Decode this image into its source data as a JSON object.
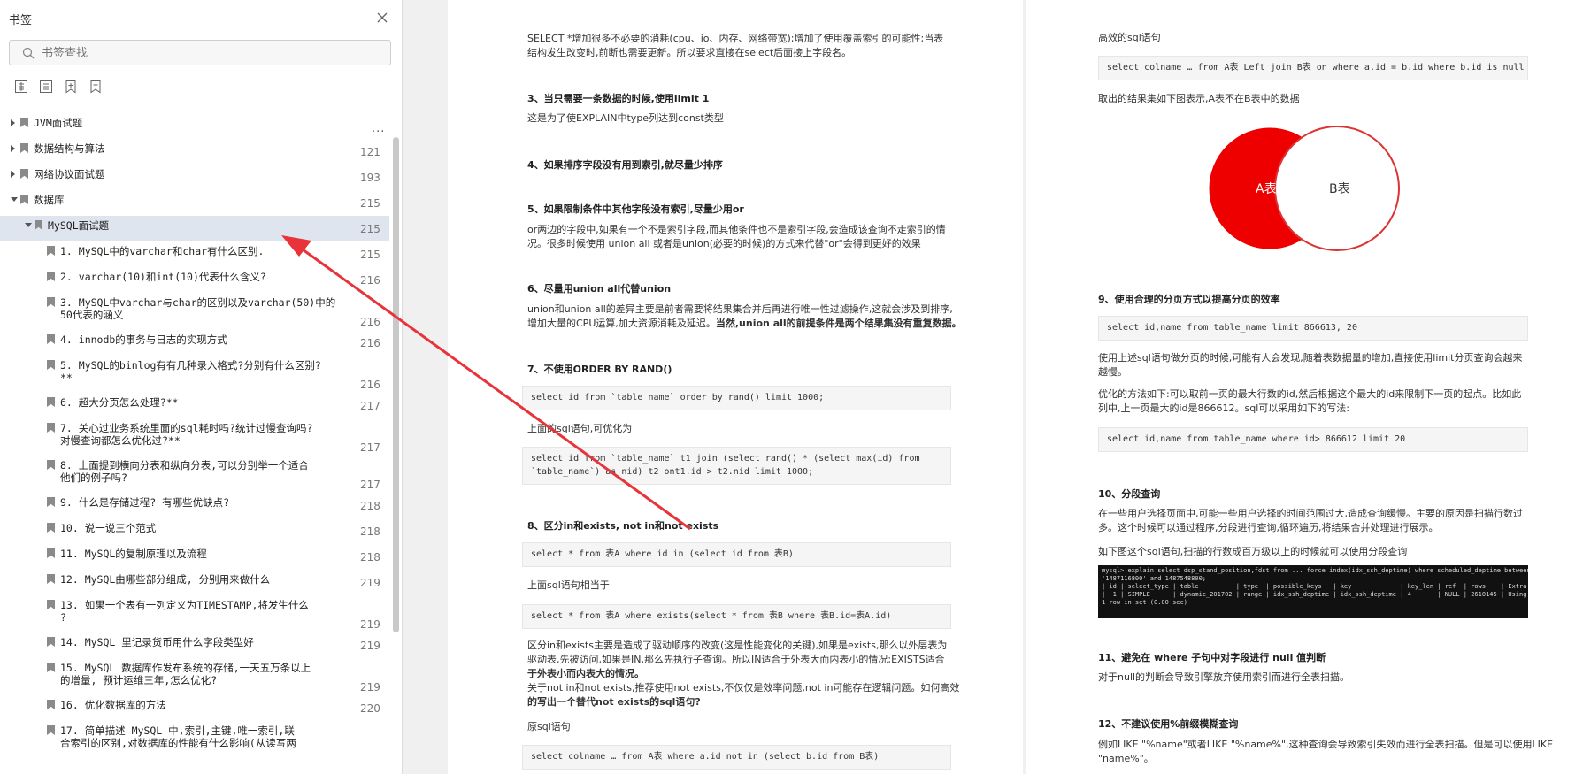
{
  "sidebar": {
    "title": "书签",
    "close_icon": "close-icon",
    "search_placeholder": "书签查找",
    "tools": [
      "expand-all-icon",
      "collapse-all-icon",
      "add-bookmark-icon",
      "bookmark-icon"
    ],
    "more": "...",
    "items": [
      {
        "label": "JVM面试题",
        "page": "",
        "level": 0,
        "state": "collapsed"
      },
      {
        "label": "数据结构与算法",
        "page": "121",
        "level": 0,
        "state": "collapsed"
      },
      {
        "label": "网络协议面试题",
        "page": "193",
        "level": 0,
        "state": "collapsed"
      },
      {
        "label": "数据库",
        "page": "215",
        "level": 0,
        "state": "expanded"
      },
      {
        "label": "MySQL面试题",
        "page": "215",
        "level": 1,
        "state": "expanded",
        "selected": true
      },
      {
        "label": "1. MySQL中的varchar和char有什么区别.",
        "page": "215",
        "level": 2
      },
      {
        "label": "2. varchar(10)和int(10)代表什么含义?",
        "page": "216",
        "level": 2
      },
      {
        "label": "3. MySQL中varchar与char的区别以及varchar(50)中的\n50代表的涵义",
        "page": "216",
        "level": 2
      },
      {
        "label": "4. innodb的事务与日志的实现方式",
        "page": "216",
        "level": 2
      },
      {
        "label": "5. MySQL的binlog有有几种录入格式?分别有什么区别?\n**",
        "page": "216",
        "level": 2
      },
      {
        "label": "6. 超大分页怎么处理?**",
        "page": "217",
        "level": 2
      },
      {
        "label": "7. 关心过业务系统里面的sql耗时吗?统计过慢查询吗?\n对慢查询都怎么优化过?**",
        "page": "217",
        "level": 2
      },
      {
        "label": "8. 上面提到横向分表和纵向分表,可以分别举一个适合\n他们的例子吗?",
        "page": "217",
        "level": 2
      },
      {
        "label": "9. 什么是存储过程? 有哪些优缺点?",
        "page": "218",
        "level": 2
      },
      {
        "label": "10. 说一说三个范式",
        "page": "218",
        "level": 2
      },
      {
        "label": "11. MySQL的复制原理以及流程",
        "page": "218",
        "level": 2
      },
      {
        "label": "12. MySQL由哪些部分组成, 分别用来做什么",
        "page": "219",
        "level": 2
      },
      {
        "label": "13. 如果一个表有一列定义为TIMESTAMP,将发生什么\n?",
        "page": "219",
        "level": 2
      },
      {
        "label": "14. MySQL 里记录货币用什么字段类型好",
        "page": "219",
        "level": 2
      },
      {
        "label": "15. MySQL 数据库作发布系统的存储,一天五万条以上\n的增量, 预计运维三年,怎么优化?",
        "page": "219",
        "level": 2
      },
      {
        "label": "16. 优化数据库的方法",
        "page": "220",
        "level": 2
      },
      {
        "label": "17. 简单描述 MySQL 中,索引,主键,唯一索引,联\n合索引的区别,对数据库的性能有什么影响(从读写两",
        "page": "",
        "level": 2
      }
    ]
  },
  "left_page": {
    "p1": "SELECT *增加很多不必要的消耗(cpu、io、内存、网络带宽);增加了使用覆盖索引的可能性;当表",
    "p1b": "结构发生改变时,前断也需要更新。所以要求直接在select后面接上字段名。",
    "h3": "3、当只需要一条数据的时候,使用limit 1",
    "t3": "这是为了使EXPLAIN中type列达到const类型",
    "h4": "4、如果排序字段没有用到索引,就尽量少排序",
    "h5": "5、如果限制条件中其他字段没有索引,尽量少用or",
    "t5a": "or两边的字段中,如果有一个不是索引字段,而其他条件也不是索引字段,会造成该查询不走索引的情",
    "t5b": "况。很多时候使用 union all 或者是union(必要的时候)的方式来代替\"or\"会得到更好的效果",
    "h6": "6、尽量用union all代替union",
    "t6a": "union和union all的差异主要是前者需要将结果集合并后再进行唯一性过滤操作,这就会涉及到排序,",
    "t6b": "增加大量的CPU运算,加大资源消耗及延迟。",
    "t6c": "当然,union all的前提条件是两个结果集没有重复数据。",
    "h7": "7、不使用ORDER BY RAND()",
    "c7": "select id from `table_name` order by rand() limit 1000;",
    "t7": "上面的sql语句,可优化为",
    "c7b1": "select id from `table_name` t1 join (select rand() * (select max(id) from",
    "c7b2": "`table_name`) as nid) t2 ont1.id > t2.nid limit 1000;",
    "h8": "8、区分in和exists, not in和not exists",
    "c8": "select * from 表A where id in (select id from 表B)",
    "t8": "上面sql语句相当于",
    "c8b": "select * from 表A where exists(select * from 表B where 表B.id=表A.id)",
    "t8a": "区分in和exists主要是造成了驱动顺序的改变(这是性能变化的关键),如果是exists,那么以外层表为",
    "t8b": "驱动表,先被访问,如果是IN,那么先执行子查询。所以IN适合于外表大而内表小的情况;EXISTS适合",
    "t8c": "于外表小而内表大的情况。",
    "t8d": "关于not in和not exists,推荐使用not exists,不仅仅是效率问题,not in可能存在逻辑问题。如何高效",
    "t8e": "的写出一个替代not exists的sql语句?",
    "t8f": "原sql语句",
    "c8c": "select colname … from A表 where a.id not in (select b.id from B表)"
  },
  "right_page": {
    "t0": "高效的sql语句",
    "c0": "select colname … from A表 Left join B表 on where a.id = b.id where b.id is null",
    "t0b": "取出的结果集如下图表示,A表不在B表中的数据",
    "venn_a": "A表",
    "venn_b": "B表",
    "venn_color": "#ee0000",
    "h9": "9、使用合理的分页方式以提高分页的效率",
    "c9": "select id,name from table_name limit 866613, 20",
    "t9a": "使用上述sql语句做分页的时候,可能有人会发现,随着表数据量的增加,直接使用limit分页查询会越来",
    "t9b": "越慢。",
    "t9c": "优化的方法如下:可以取前一页的最大行数的id,然后根据这个最大的id来限制下一页的起点。比如此",
    "t9d": "列中,上一页最大的id是866612。sql可以采用如下的写法:",
    "c9b": "select id,name from table_name where id> 866612 limit 20",
    "h10": "10、分段查询",
    "t10a": "在一些用户选择页面中,可能一些用户选择的时间范围过大,造成查询缓慢。主要的原因是扫描行数过",
    "t10b": "多。这个时候可以通过程序,分段进行查询,循环遍历,将结果合并处理进行展示。",
    "t10c": "如下图这个sql语句,扫描的行数成百万级以上的时候就可以使用分段查询",
    "shot1": "mysql> explain select dsp_stand_position,fdst from ... force index(idx_ssh_deptime) where scheduled_deptime between",
    "shot2": "'1487116800' and 1487548800;",
    "shot3": "| id | select_type | table          | type  | possible_keys   | key             | key_len | ref  | rows    | Extra",
    "shot4": "|  1 | SIMPLE      | dynamic_201702 | range | idx_ssh_deptime | idx_ssh_deptime | 4       | NULL | 2610145 | Using index condition",
    "shot5": "1 row in set (0.00 sec)",
    "h11": "11、避免在 where 子句中对字段进行 null 值判断",
    "t11": "对于null的判断会导致引擎放弃使用索引而进行全表扫描。",
    "h12": "12、不建议使用%前缀模糊查询",
    "t12a": "例如LIKE \"%name\"或者LIKE \"%name%\",这种查询会导致索引失效而进行全表扫描。但是可以使用LIKE",
    "t12b": "\"name%\"。"
  },
  "annotation": {
    "color": "#e8333a"
  }
}
